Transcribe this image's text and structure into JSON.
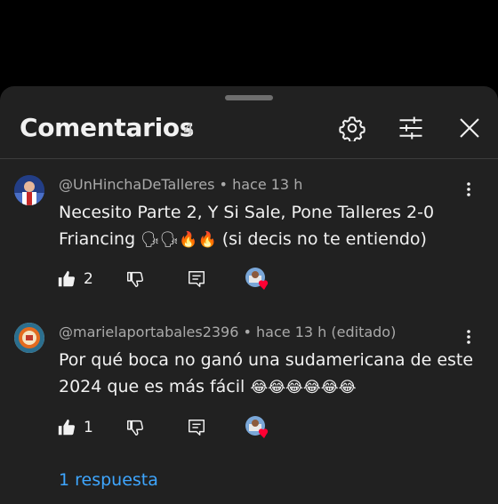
{
  "header": {
    "title": "Comentarios",
    "count": "4"
  },
  "icons": {
    "settings": "gear-icon",
    "filter": "sliders-icon",
    "close": "close-icon",
    "like": "thumb-up-icon",
    "dislike": "thumb-down-icon",
    "reply": "reply-icon",
    "more": "more-vert-icon",
    "creator_heart": "creator-heart-icon"
  },
  "comments": [
    {
      "author": "@UnHinchaDeTalleres",
      "time": "• hace 13 h",
      "text_line1": "Necesito Parte 2, Y Si Sale, Pone Talleres 2-0",
      "text_line2_prefix": "Friancing ",
      "text_line2_emoji": "🗣🗣🔥🔥",
      "text_line2_suffix": " (si decis no te entiendo)",
      "likes": "2"
    },
    {
      "author": "@marielaportabales2396",
      "time": "• hace 13 h (editado)",
      "text_line1": "Por qué boca no ganó una sudamericana de este",
      "text_line2_prefix": "2024 que es más fácil ",
      "text_line2_emoji": "😂😂😂😂😂😂",
      "likes": "1",
      "replies_link": "1 respuesta"
    }
  ],
  "colors": {
    "sheet_bg": "#212121",
    "link": "#3ea6ff",
    "heart": "#ff0033"
  }
}
